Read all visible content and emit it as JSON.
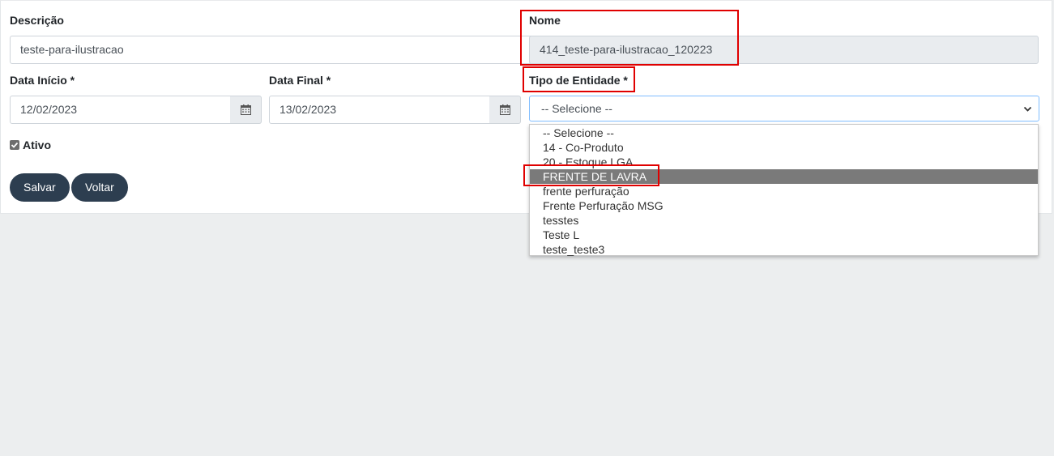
{
  "form": {
    "descricao": {
      "label": "Descrição",
      "value": "teste-para-ilustracao"
    },
    "nome": {
      "label": "Nome",
      "value": "414_teste-para-ilustracao_120223"
    },
    "data_inicio": {
      "label": "Data Início *",
      "value": "12/02/2023"
    },
    "data_final": {
      "label": "Data Final *",
      "value": "13/02/2023"
    },
    "tipo_entidade": {
      "label": "Tipo de Entidade *",
      "value": "-- Selecione --",
      "options": [
        "-- Selecione --",
        "14 - Co-Produto",
        "20 - Estoque LGA",
        "FRENTE DE LAVRA",
        "frente perfuração",
        "Frente Perfuração MSG",
        "tesstes",
        "Teste L",
        "teste_teste3"
      ],
      "highlighted_option": "FRENTE DE LAVRA"
    },
    "ativo": {
      "label": "Ativo",
      "checked": true
    }
  },
  "buttons": {
    "save_label": "Salvar",
    "back_label": "Voltar"
  },
  "icons": {
    "calendar": "calendar-icon",
    "dropdown": "chevron-down-icon",
    "check": "check-icon"
  },
  "colors": {
    "button_bg": "#2d3e50",
    "highlight": "#7a7a7a",
    "annotation": "#e00000",
    "page_bg": "#eceeef"
  }
}
